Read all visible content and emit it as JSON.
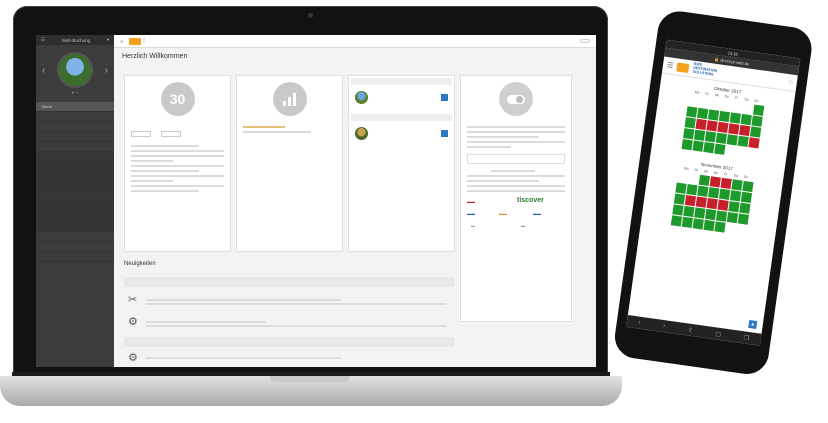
{
  "laptop": {
    "sidebar": {
      "title": "Web-Buchung",
      "user": "",
      "items": [
        {
          "label": "Menü",
          "sub": false
        },
        {
          "label": "",
          "sub": false
        },
        {
          "label": "",
          "sub": false
        },
        {
          "label": "",
          "sub": false
        },
        {
          "label": "",
          "sub": false
        },
        {
          "label": "",
          "sub": true
        },
        {
          "label": "",
          "sub": true
        },
        {
          "label": "",
          "sub": true
        },
        {
          "label": "",
          "sub": true
        },
        {
          "label": "",
          "sub": true
        },
        {
          "label": "",
          "sub": true
        },
        {
          "label": "",
          "sub": true
        },
        {
          "label": "",
          "sub": true
        },
        {
          "label": "",
          "sub": false
        },
        {
          "label": "",
          "sub": false
        },
        {
          "label": "",
          "sub": false
        }
      ]
    },
    "topbar": {
      "right_button": ""
    },
    "greeting": "Herzlich Willkommen",
    "cards": {
      "days_card": {
        "title": "",
        "value": "30"
      },
      "stats_card": {
        "title": ""
      },
      "contacts_card": {
        "title": ""
      },
      "toggle_card": {
        "title": ""
      }
    },
    "notices": {
      "title": "Neuigkeiten"
    },
    "sponsors": [
      "",
      "tiscover",
      "",
      "",
      ""
    ]
  },
  "phone": {
    "time": "13:16",
    "url": "devsv.pr-web.de",
    "brand_lines": [
      "BWS",
      "DESTINATION",
      "SOLUTIONS"
    ],
    "calendars": [
      {
        "title": "Oktober 2017",
        "weekdays": [
          "Mo",
          "Di",
          "Mi",
          "Do",
          "Fr",
          "Sa",
          "So"
        ],
        "cells": [
          "e",
          "e",
          "e",
          "e",
          "e",
          "e",
          "g",
          "g",
          "g",
          "g",
          "g",
          "g",
          "g",
          "g",
          "g",
          "r",
          "r",
          "r",
          "r",
          "r",
          "g",
          "g",
          "g",
          "g",
          "g",
          "g",
          "g",
          "r",
          "g",
          "g",
          "g",
          "g",
          "e",
          "e",
          "e"
        ]
      },
      {
        "title": "November 2017",
        "weekdays": [
          "Mo",
          "Di",
          "Mi",
          "Do",
          "Fr",
          "Sa",
          "So"
        ],
        "cells": [
          "e",
          "e",
          "g",
          "r",
          "r",
          "g",
          "g",
          "g",
          "g",
          "g",
          "g",
          "g",
          "g",
          "g",
          "g",
          "r",
          "r",
          "r",
          "r",
          "g",
          "g",
          "g",
          "g",
          "g",
          "g",
          "g",
          "g",
          "g",
          "g",
          "g",
          "g",
          "g",
          "g",
          "e",
          "e"
        ]
      }
    ]
  }
}
